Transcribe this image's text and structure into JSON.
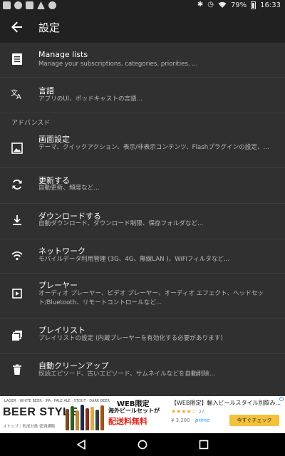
{
  "status_bar": {
    "battery": "79%",
    "time": "16:33",
    "left_icons": [
      "notification-icon",
      "podcast-icon",
      "gallery-icon",
      "warning-icon",
      "android-icon"
    ],
    "right_icons": [
      "bluetooth-icon",
      "alarm-icon",
      "wifi-icon",
      "battery-icon"
    ]
  },
  "app_bar": {
    "title": "設定"
  },
  "items": [
    {
      "icon": "list-icon",
      "title": "Manage lists",
      "subtitle": "Manage your subscriptions, categories, priorities, ..."
    },
    {
      "icon": "translate-icon",
      "title": "言語",
      "subtitle": "アプリのUI、ポッドキャストの言語..."
    }
  ],
  "section_header": "アドバンスド",
  "advanced_items": [
    {
      "icon": "image-icon",
      "title": "画面設定",
      "subtitle": "テーマ、クイックアクション、表示/非表示コンテンツ、Flashプラグインの設定、..."
    },
    {
      "icon": "refresh-icon",
      "title": "更新する",
      "subtitle": "自動更新、頻度など..."
    },
    {
      "icon": "download-icon",
      "title": "ダウンロードする",
      "subtitle": "自動ダウンロード、ダウンロード制限、保存フォルダなど..."
    },
    {
      "icon": "wifi-icon",
      "title": "ネットワーク",
      "subtitle": "モバイルデータ利用管理 (3G、4G、無線LAN )、WiFiフィルタなど..."
    },
    {
      "icon": "player-icon",
      "title": "プレーヤー",
      "subtitle": "オーディオ プレーヤー、ビデオ プレーヤー、オーディオ エフェクト、ヘッドセット/Bluetooth、リモートコントロールなど..."
    },
    {
      "icon": "playlist-icon",
      "title": "プレイリスト",
      "subtitle": "プレイリストの設定 (内蔵プレーヤーを有効化する必要があります)"
    },
    {
      "icon": "trash-icon",
      "title": "自動クリーンアップ",
      "subtitle": "既読エピソード、古いエピソード、サムネイルなどを自動削除..."
    }
  ],
  "ad": {
    "beer_types": "LAGER · WHITE BEER · IPA · PALE ALE · STOUT · DARK BEER",
    "brand": "BEER STYLE",
    "brand_sub": "ストップ｜乳成分飲 密酒通販",
    "headline": "WEB限定",
    "subline": "海外ビールセットが",
    "promo": "配送料無料",
    "product": "【WEB限定】輸入ビールスタイル別飲み...",
    "stars": "★★★★☆",
    "rating_count": "27",
    "price": "¥ 3,280",
    "prime": "prime",
    "cta": "今すぐチェック"
  },
  "nav_bar": {
    "buttons": [
      "back-icon",
      "home-icon",
      "recents-icon"
    ]
  },
  "colors": {
    "background": "#303030",
    "app_bar": "#212121",
    "divider": "#3d3d3d",
    "secondary_text": "#b9b9b9",
    "ad_promo_red": "#e0231a",
    "ad_button": "#f3c13a"
  }
}
